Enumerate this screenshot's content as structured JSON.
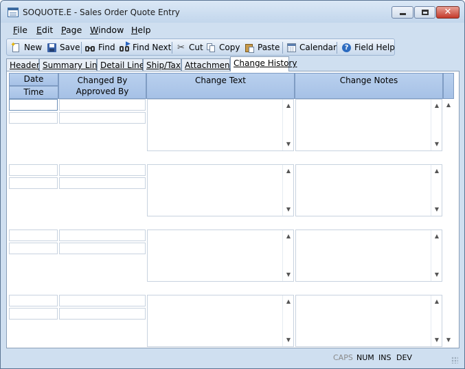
{
  "window": {
    "title": "SOQUOTE.E - Sales Order Quote Entry"
  },
  "menu": [
    {
      "label": "File",
      "accel": "F",
      "rest": "ile"
    },
    {
      "label": "Edit",
      "accel": "E",
      "rest": "dit"
    },
    {
      "label": "Page",
      "accel": "P",
      "rest": "age"
    },
    {
      "label": "Window",
      "accel": "W",
      "rest": "indow"
    },
    {
      "label": "Help",
      "accel": "H",
      "rest": "elp"
    }
  ],
  "toolbar": {
    "new": "New",
    "save": "Save",
    "find": "Find",
    "find_next": "Find Next",
    "cut": "Cut",
    "copy": "Copy",
    "paste": "Paste",
    "calendar": "Calendar",
    "field_help": "Field Help"
  },
  "tabs": [
    "Header",
    "Summary Lines",
    "Detail Lines",
    "Ship/Tax",
    "Attachments",
    "Change History"
  ],
  "active_tab": "Change History",
  "columns": {
    "date": "Date",
    "time": "Time",
    "changed_by": "Changed By",
    "approved_by": "Approved By",
    "change_text": "Change Text",
    "change_notes": "Change Notes"
  },
  "rows": [
    {
      "date": "",
      "time": "",
      "changed_by": "",
      "approved_by": "",
      "change_text": "",
      "change_notes": ""
    },
    {
      "date": "",
      "time": "",
      "changed_by": "",
      "approved_by": "",
      "change_text": "",
      "change_notes": ""
    },
    {
      "date": "",
      "time": "",
      "changed_by": "",
      "approved_by": "",
      "change_text": "",
      "change_notes": ""
    },
    {
      "date": "",
      "time": "",
      "changed_by": "",
      "approved_by": "",
      "change_text": "",
      "change_notes": ""
    }
  ],
  "status": {
    "caps": "CAPS",
    "num": "NUM",
    "ins": "INS",
    "dev": "DEV"
  },
  "colors": {
    "window_bg": "#cfdff0",
    "header_blue": "#a6c1e6",
    "caps_disabled": "#8a8a8a"
  }
}
